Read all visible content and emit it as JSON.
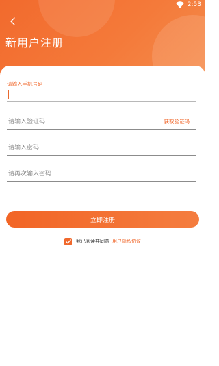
{
  "status_bar": {
    "time": "2:53",
    "wifi_icon": "wifi-icon"
  },
  "header": {
    "back_icon": "chevron-left-icon",
    "title": "新用户注册"
  },
  "form": {
    "phone": {
      "label": "请输入手机号码",
      "value": "",
      "placeholder": ""
    },
    "code": {
      "value": "",
      "placeholder": "请输入验证码",
      "get_code_label": "获取验证码"
    },
    "password": {
      "value": "",
      "placeholder": "请输入密码"
    },
    "confirm_password": {
      "value": "",
      "placeholder": "请再次输入密码"
    }
  },
  "register_button": {
    "label": "立即注册"
  },
  "agreement": {
    "checked": true,
    "text": "我已阅读并同意",
    "link": "用户隐私协议",
    "check_icon": "checkmark-icon"
  },
  "colors": {
    "accent": "#f0682c",
    "header_start": "#f26a2d",
    "header_end": "#f58e4e",
    "text_placeholder": "#8a8a8a"
  }
}
